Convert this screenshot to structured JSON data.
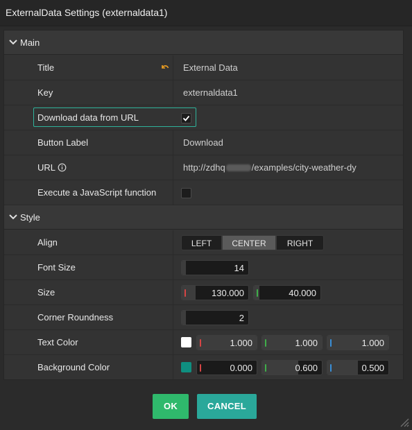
{
  "window": {
    "title": "ExternalData Settings (externaldata1)"
  },
  "sections": {
    "main": "Main",
    "style": "Style"
  },
  "main": {
    "title": {
      "label": "Title",
      "value": "External Data"
    },
    "key": {
      "label": "Key",
      "value": "externaldata1"
    },
    "download": {
      "label": "Download data from URL",
      "checked": true
    },
    "button_label": {
      "label": "Button Label",
      "value": "Download"
    },
    "url": {
      "label": "URL",
      "value_prefix": "http://zdhq",
      "value_suffix": "/examples/city-weather-dy"
    },
    "execute_js": {
      "label": "Execute a JavaScript function",
      "checked": false
    }
  },
  "style": {
    "align": {
      "label": "Align",
      "options": [
        "LEFT",
        "CENTER",
        "RIGHT"
      ],
      "selected": "CENTER"
    },
    "font_size": {
      "label": "Font Size",
      "value": "14"
    },
    "size": {
      "label": "Size",
      "width": "130.000",
      "height": "40.000"
    },
    "corner_roundness": {
      "label": "Corner Roundness",
      "value": "2"
    },
    "text_color": {
      "label": "Text Color",
      "swatch": "#ffffff",
      "r": "1.000",
      "g": "1.000",
      "b": "1.000"
    },
    "background_color": {
      "label": "Background Color",
      "swatch": "#0f8f80",
      "r": "0.000",
      "g": "0.600",
      "b": "0.500"
    }
  },
  "buttons": {
    "ok": "OK",
    "cancel": "CANCEL"
  },
  "colors": {
    "accent": "#2fb39b",
    "ok": "#2fb96c",
    "cancel": "#2aa89a",
    "revert": "#f0a020",
    "red": "#d64545",
    "green": "#3fae4a",
    "blue": "#3a8fd8"
  }
}
